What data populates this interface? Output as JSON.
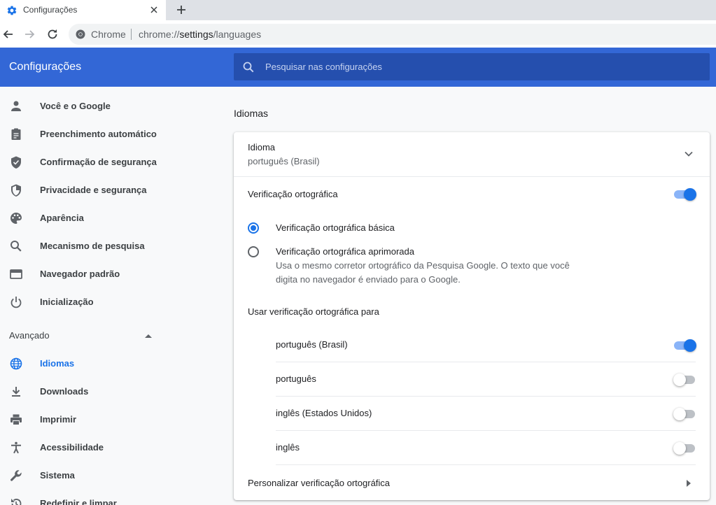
{
  "browser": {
    "tab_title": "Configurações",
    "omnibox_site": "Chrome",
    "url_scheme": "chrome://",
    "url_host": "settings",
    "url_path": "/languages"
  },
  "header": {
    "title": "Configurações",
    "search_placeholder": "Pesquisar nas configurações"
  },
  "sidebar": {
    "items": [
      {
        "label": "Você e o Google",
        "icon": "person-icon"
      },
      {
        "label": "Preenchimento automático",
        "icon": "clipboard-icon"
      },
      {
        "label": "Confirmação de segurança",
        "icon": "shield-check-icon"
      },
      {
        "label": "Privacidade e segurança",
        "icon": "shield-icon"
      },
      {
        "label": "Aparência",
        "icon": "palette-icon"
      },
      {
        "label": "Mecanismo de pesquisa",
        "icon": "search-icon"
      },
      {
        "label": "Navegador padrão",
        "icon": "browser-window-icon"
      },
      {
        "label": "Inicialização",
        "icon": "power-icon"
      }
    ],
    "advanced_label": "Avançado",
    "advanced_items": [
      {
        "label": "Idiomas",
        "icon": "globe-icon",
        "active": true
      },
      {
        "label": "Downloads",
        "icon": "download-icon"
      },
      {
        "label": "Imprimir",
        "icon": "printer-icon"
      },
      {
        "label": "Acessibilidade",
        "icon": "accessibility-icon"
      },
      {
        "label": "Sistema",
        "icon": "wrench-icon"
      },
      {
        "label": "Redefinir e limpar",
        "icon": "reset-icon"
      }
    ]
  },
  "main": {
    "section_title": "Idiomas",
    "language_label": "Idioma",
    "language_value": "português (Brasil)",
    "spellcheck_label": "Verificação ortográfica",
    "spellcheck_enabled": true,
    "radio_basic_label": "Verificação ortográfica básica",
    "radio_enhanced_label": "Verificação ortográfica aprimorada",
    "radio_enhanced_desc_1": "Usa o mesmo corretor ortográfico da Pesquisa Google. O texto que você",
    "radio_enhanced_desc_2": "digita no navegador é enviado para o Google.",
    "selected_mode": "basic",
    "use_for_label": "Usar verificação ortográfica para",
    "languages": [
      {
        "name": "português (Brasil)",
        "enabled": true
      },
      {
        "name": "português",
        "enabled": false
      },
      {
        "name": "inglês (Estados Unidos)",
        "enabled": false
      },
      {
        "name": "inglês",
        "enabled": false
      }
    ],
    "customize_label": "Personalizar verificação ortográfica"
  },
  "colors": {
    "header_blue": "#3367d6",
    "search_blue": "#254fae",
    "accent": "#1a73e8"
  }
}
